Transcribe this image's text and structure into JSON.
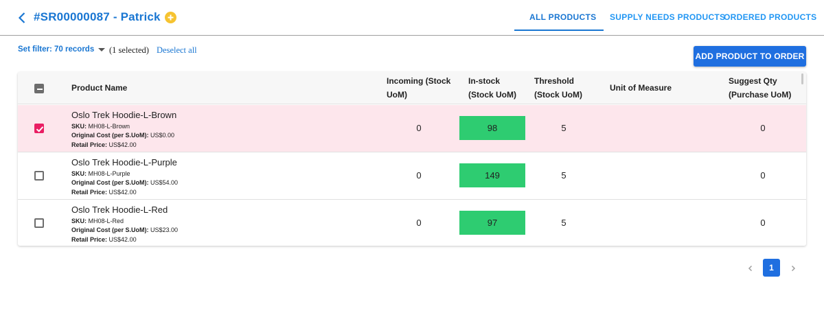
{
  "header": {
    "title": "#SR00000087 - Patrick",
    "tabs": [
      {
        "label": "ALL PRODUCTS",
        "active": true
      },
      {
        "label": "SUPPLY NEEDS PRODUCTS",
        "active": false
      },
      {
        "label": "ORDERED PRODUCTS",
        "active": false
      }
    ]
  },
  "toolbar": {
    "filter_label": "Set filter: 70 records",
    "selected_text": "(1 selected)",
    "deselect_label": "Deselect all",
    "add_button_label": "ADD PRODUCT TO ORDER"
  },
  "table": {
    "columns": {
      "product_name": "Product Name",
      "incoming_1": "Incoming (Stock",
      "incoming_2": "UoM)",
      "instock_1": "In-stock",
      "instock_2": "(Stock UoM)",
      "threshold_1": "Threshold",
      "threshold_2": "(Stock UoM)",
      "uom": "Unit of Measure",
      "suggest_1": "Suggest Qty",
      "suggest_2": "(Purchase UoM)"
    },
    "labels": {
      "sku": "SKU:",
      "original_cost": "Original Cost (per S.UoM):",
      "retail_price": "Retail Price:"
    },
    "rows": [
      {
        "name": "Oslo Trek Hoodie-L-Brown",
        "sku": "MH08-L-Brown",
        "original_cost": "US$0.00",
        "retail_price": "US$42.00",
        "incoming": "0",
        "in_stock": "98",
        "threshold": "5",
        "uom": "",
        "suggest_qty": "0",
        "selected": true
      },
      {
        "name": "Oslo Trek Hoodie-L-Purple",
        "sku": "MH08-L-Purple",
        "original_cost": "US$54.00",
        "retail_price": "US$42.00",
        "incoming": "0",
        "in_stock": "149",
        "threshold": "5",
        "uom": "",
        "suggest_qty": "0",
        "selected": false
      },
      {
        "name": "Oslo Trek Hoodie-L-Red",
        "sku": "MH08-L-Red",
        "original_cost": "US$23.00",
        "retail_price": "US$42.00",
        "incoming": "0",
        "in_stock": "97",
        "threshold": "5",
        "uom": "",
        "suggest_qty": "0",
        "selected": false
      }
    ]
  },
  "pagination": {
    "current_page": "1"
  },
  "colors": {
    "accent": "#1976d2",
    "button": "#1f6fe0",
    "stock_ok": "#2ecc71",
    "selected_row": "#fde6ec",
    "checkbox_checked": "#e91e63",
    "add_icon": "#f6c330"
  }
}
